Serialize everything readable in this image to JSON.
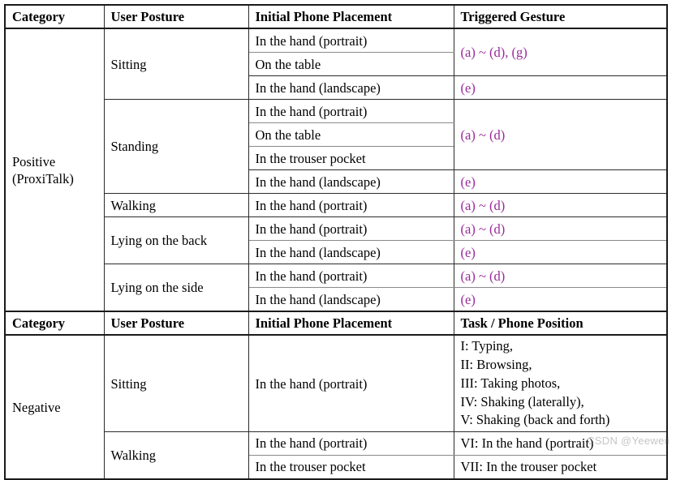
{
  "table": {
    "headers_primary": {
      "category": "Category",
      "posture": "User Posture",
      "placement": "Initial Phone Placement",
      "gesture": "Triggered Gesture"
    },
    "headers_secondary": {
      "category": "Category",
      "posture": "User Posture",
      "placement": "Initial Phone Placement",
      "gesture": "Task / Phone Position"
    },
    "accent_color": "#992a99",
    "positive": {
      "category_line1": "Positive",
      "category_line2": "(ProxiTalk)",
      "rows": [
        {
          "posture": "Sitting",
          "placement": "In the hand (portrait)",
          "gesture": "(a) ~ (d), (g)"
        },
        {
          "posture": "Sitting",
          "placement": "On the table",
          "gesture": "(a) ~ (d), (g)"
        },
        {
          "posture": "Sitting",
          "placement": "In the hand (landscape)",
          "gesture": "(e)"
        },
        {
          "posture": "Standing",
          "placement": "In the hand (portrait)",
          "gesture": "(a) ~ (d)"
        },
        {
          "posture": "Standing",
          "placement": "On the table",
          "gesture": "(a) ~ (d)"
        },
        {
          "posture": "Standing",
          "placement": "In the trouser pocket",
          "gesture": "(a) ~ (d)"
        },
        {
          "posture": "Standing",
          "placement": "In the hand (landscape)",
          "gesture": "(e)"
        },
        {
          "posture": "Walking",
          "placement": "In the hand (portrait)",
          "gesture": "(a) ~ (d)"
        },
        {
          "posture": "Lying on the back",
          "placement": "In the hand (portrait)",
          "gesture": "(a) ~ (d)"
        },
        {
          "posture": "Lying on the back",
          "placement": "In the hand (landscape)",
          "gesture": "(e)"
        },
        {
          "posture": "Lying on the side",
          "placement": "In the hand (portrait)",
          "gesture": "(a) ~ (d)"
        },
        {
          "posture": "Lying on the side",
          "placement": "In the hand (landscape)",
          "gesture": "(e)"
        }
      ]
    },
    "negative": {
      "category": "Negative",
      "sitting_posture": "Sitting",
      "sitting_placement": "In the hand (portrait)",
      "sitting_tasks": [
        "I: Typing,",
        "II: Browsing,",
        "III: Taking photos,",
        "IV: Shaking (laterally),",
        "V: Shaking (back and forth)"
      ],
      "walking_posture": "Walking",
      "walking_rows": [
        {
          "placement": "In the hand (portrait)",
          "task": "VI: In the hand (portrait)"
        },
        {
          "placement": "In the trouser pocket",
          "task": "VII: In the trouser pocket"
        }
      ]
    }
  },
  "watermark": "CSDN @Yeeweii"
}
